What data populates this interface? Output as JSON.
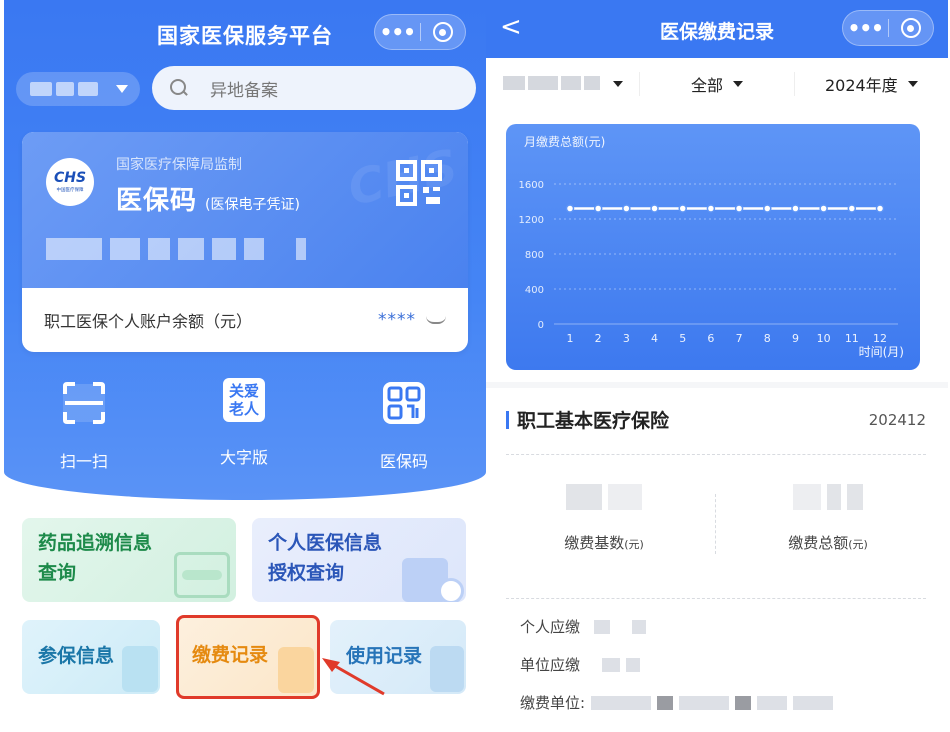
{
  "left": {
    "title": "国家医保服务平台",
    "search_placeholder": "异地备案",
    "card": {
      "supervisor": "国家医疗保障局监制",
      "logo_text": "CHS",
      "logo_sub": "中国医疗保障",
      "name": "医保码",
      "name_note": "(医保电子凭证)",
      "balance_label": "职工医保个人账户余额（元）",
      "balance_value": "****"
    },
    "quick_actions": [
      {
        "label": "扫一扫",
        "icon": "scan-icon"
      },
      {
        "label": "大字版",
        "icon": "elder-care-icon",
        "icon_text_1": "关爱",
        "icon_text_2": "老人"
      },
      {
        "label": "医保码",
        "icon": "qr-code-icon"
      }
    ],
    "tiles": {
      "drug_trace_1": "药品追溯信息",
      "drug_trace_2": "查询",
      "auth_1": "个人医保信息",
      "auth_2": "授权查询",
      "insured": "参保信息",
      "payment": "缴费记录",
      "usage": "使用记录"
    }
  },
  "right": {
    "title": "医保缴费记录",
    "back_glyph": "<",
    "filters": {
      "type": "全部",
      "year": "2024年度"
    },
    "colors": {
      "primary": "#3a78f2",
      "highlight": "#e03a2a"
    },
    "chart_data": {
      "type": "line",
      "title": "月缴费总额(元)",
      "xlabel": "时间(月)",
      "ylabel": "",
      "categories": [
        "1",
        "2",
        "3",
        "4",
        "5",
        "6",
        "7",
        "8",
        "9",
        "10",
        "11",
        "12"
      ],
      "values": [
        1320,
        1320,
        1320,
        1320,
        1320,
        1320,
        1320,
        1320,
        1320,
        1320,
        1320,
        1320
      ],
      "yticks": [
        0,
        400,
        800,
        1200,
        1600
      ],
      "ylim": [
        0,
        1600
      ],
      "grid": true
    },
    "insurance": {
      "name": "职工基本医疗保险",
      "period": "202412",
      "base_label": "缴费基数",
      "base_unit": "(元)",
      "total_label": "缴费总额",
      "total_unit": "(元)",
      "personal_label": "个人应缴",
      "unit_label": "单位应缴",
      "payer_label": "缴费单位:"
    }
  }
}
